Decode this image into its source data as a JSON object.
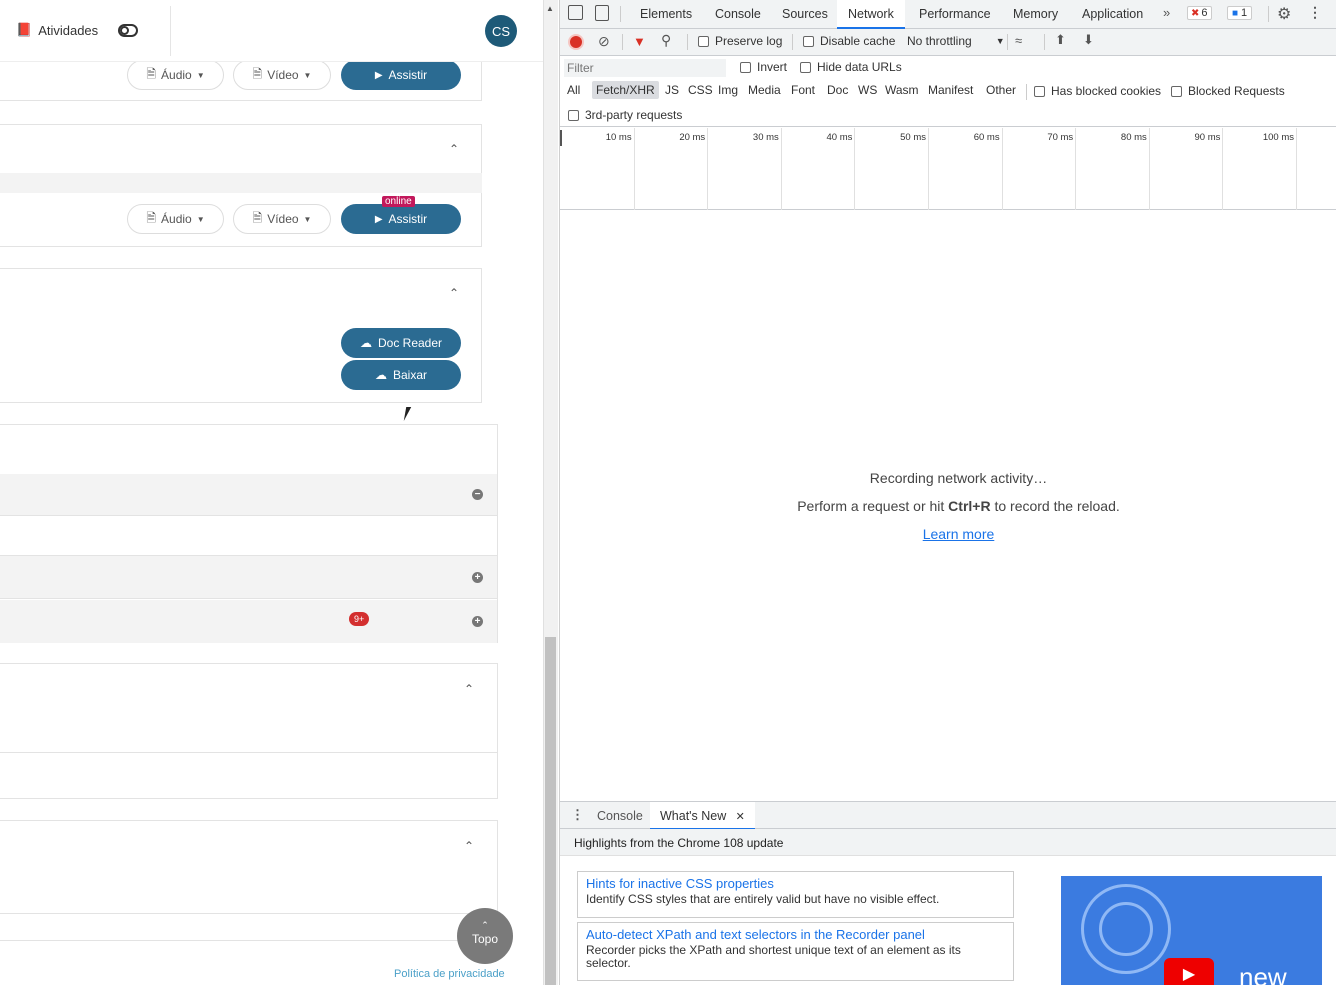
{
  "left": {
    "topbar": {
      "activities_label": "Atividades",
      "avatar_initials": "CS"
    },
    "media_card_1": {
      "audio_label": "Áudio",
      "video_label": "Vídeo",
      "watch_label": "Assistir"
    },
    "media_card_2": {
      "audio_label": "Áudio",
      "video_label": "Vídeo",
      "watch_label": "Assistir",
      "online_badge": "online"
    },
    "doc_card": {
      "doc_reader_label": "Doc Reader",
      "download_label": "Baixar"
    },
    "list": {
      "badge_count": "9+"
    },
    "top_button": {
      "label": "Topo"
    },
    "privacy_link": "Política de privacidade"
  },
  "devtools": {
    "tabs": [
      "Elements",
      "Console",
      "Sources",
      "Network",
      "Performance",
      "Memory",
      "Application"
    ],
    "active_tab": "Network",
    "error_count": "6",
    "message_count": "1",
    "toolbar": {
      "preserve_log": "Preserve log",
      "disable_cache": "Disable cache",
      "throttling": "No throttling"
    },
    "filter": {
      "placeholder": "Filter",
      "invert": "Invert",
      "hide_data_urls": "Hide data URLs"
    },
    "types": [
      "All",
      "Fetch/XHR",
      "JS",
      "CSS",
      "Img",
      "Media",
      "Font",
      "Doc",
      "WS",
      "Wasm",
      "Manifest",
      "Other"
    ],
    "active_type": "Fetch/XHR",
    "has_blocked_cookies": "Has blocked cookies",
    "blocked_requests": "Blocked Requests",
    "third_party": "3rd-party requests",
    "timeline_ticks": [
      "10 ms",
      "20 ms",
      "30 ms",
      "40 ms",
      "50 ms",
      "60 ms",
      "70 ms",
      "80 ms",
      "90 ms",
      "100 ms"
    ],
    "empty_state": {
      "title": "Recording network activity…",
      "hint_prefix": "Perform a request or hit ",
      "hint_shortcut": "Ctrl+R",
      "hint_suffix": " to record the reload.",
      "learn_more": "Learn more"
    },
    "drawer": {
      "tabs": [
        "Console",
        "What's New"
      ],
      "active_tab": "What's New",
      "headline": "Highlights from the Chrome 108 update",
      "features": [
        {
          "title": "Hints for inactive CSS properties",
          "desc": "Identify CSS styles that are entirely valid but have no visible effect."
        },
        {
          "title": "Auto-detect XPath and text selectors in the Recorder panel",
          "desc": "Recorder picks the XPath and shortest unique text of an element as its selector."
        }
      ],
      "video_text": "new"
    }
  }
}
